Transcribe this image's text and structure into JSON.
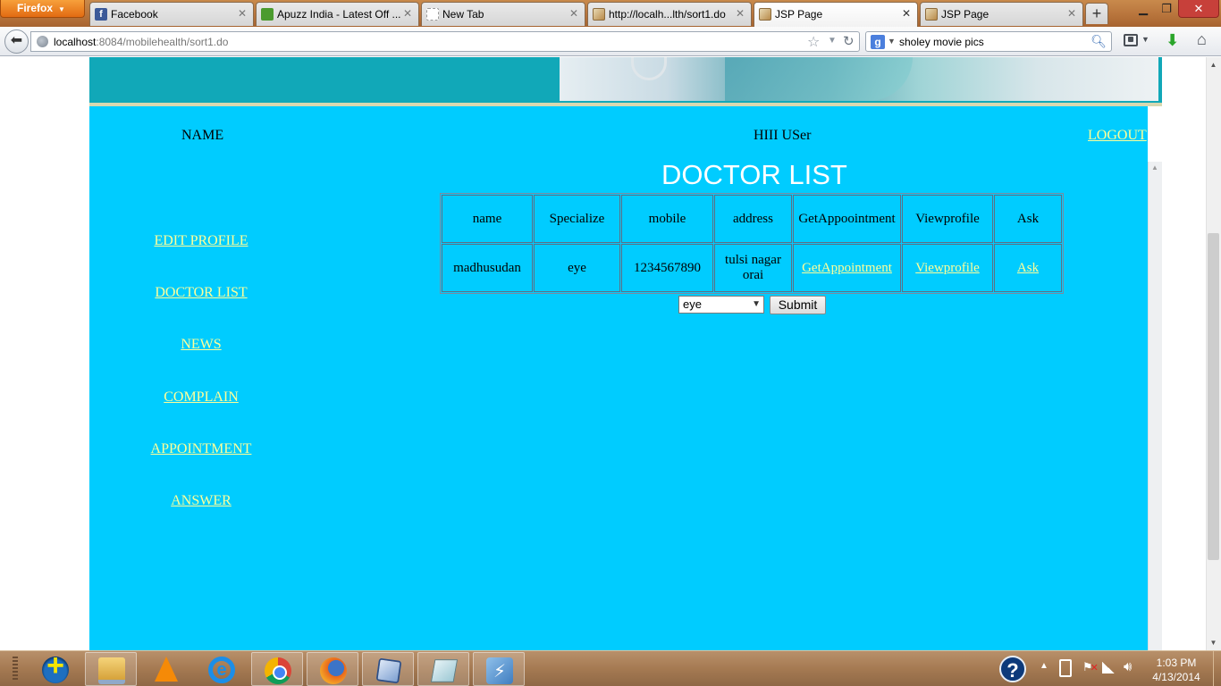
{
  "browser": {
    "menu_button_label": "Firefox",
    "tabs": [
      {
        "title": "Facebook",
        "favicon": "facebook-icon",
        "active": false
      },
      {
        "title": "Apuzz India - Latest Off ...",
        "favicon": "apuzz-icon",
        "active": false
      },
      {
        "title": "New Tab",
        "favicon": "blank-page-icon",
        "active": false
      },
      {
        "title": "http://localh...lth/sort1.do",
        "favicon": "image-page-icon",
        "active": false
      },
      {
        "title": "JSP Page",
        "favicon": "image-page-icon",
        "active": true
      },
      {
        "title": "JSP Page",
        "favicon": "image-page-icon",
        "active": false
      }
    ],
    "url_host": "localhost",
    "url_rest": ":8084/mobilehealth/sort1.do",
    "search_text": "sholey movie pics",
    "search_engine_letter": "g"
  },
  "page": {
    "name_label": "NAME",
    "greeting": "HIII USer",
    "logout_label": "LOGOUT",
    "sidebar_links": [
      "EDIT PROFILE",
      "DOCTOR LIST",
      "NEWS",
      "COMPLAIN",
      "APPOINTMENT",
      "ANSWER"
    ],
    "title": "DOCTOR LIST",
    "table": {
      "headers": [
        "name",
        "Specialize",
        "mobile",
        "address",
        "GetAppoointment",
        "Viewprofile",
        "Ask"
      ],
      "rows": [
        {
          "name": "madhusudan",
          "specialize": "eye",
          "mobile": "1234567890",
          "address": "tulsi nagar orai",
          "get_appointment_link": "GetAppointment",
          "view_profile_link": "Viewprofile",
          "ask_link": "Ask"
        }
      ]
    },
    "filter_select_value": "eye",
    "submit_label": "Submit",
    "colors": {
      "panel_bg": "#00ccff",
      "header_band": "#11a8b8",
      "link_color": "#ffff99",
      "title_color": "#ffffff"
    }
  },
  "taskbar": {
    "apps": [
      "health-app-icon",
      "file-explorer-icon",
      "vlc-icon",
      "internet-explorer-icon",
      "chrome-icon",
      "firefox-icon",
      "virtualbox-icon",
      "document-app-icon",
      "flash-app-icon"
    ],
    "clock_time": "1:03 PM",
    "clock_date": "4/13/2014"
  }
}
